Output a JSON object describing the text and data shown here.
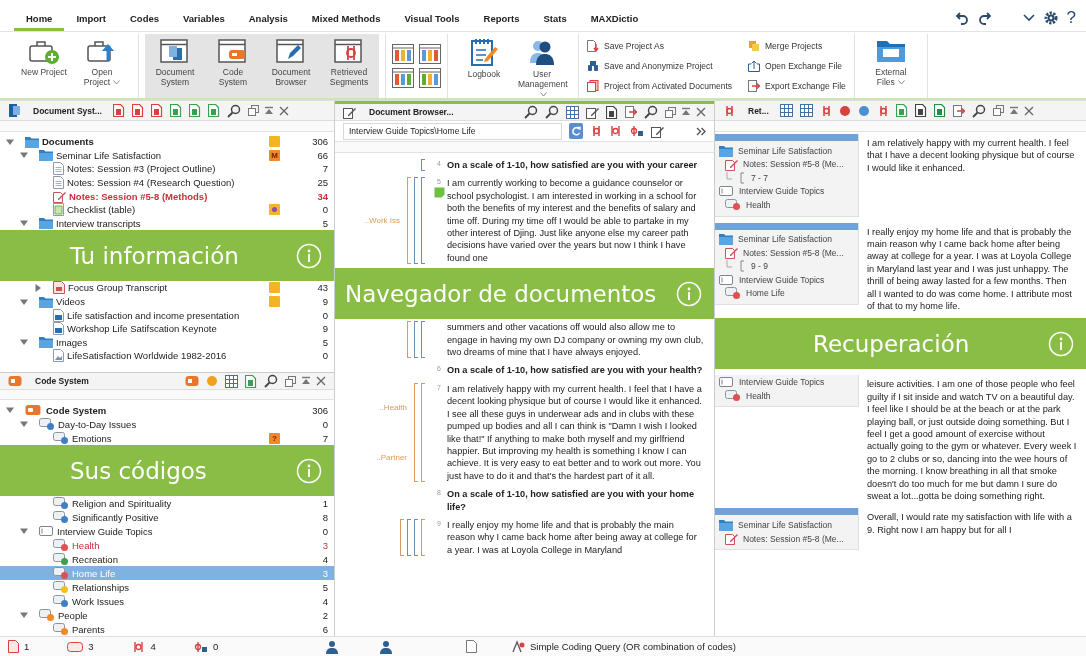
{
  "ribbon": {
    "tabs": [
      {
        "label": "Home",
        "selected": true
      },
      {
        "label": "Import",
        "selected": false
      },
      {
        "label": "Codes",
        "selected": false
      },
      {
        "label": "Variables",
        "selected": false
      },
      {
        "label": "Analysis",
        "selected": false
      },
      {
        "label": "Mixed Methods",
        "selected": false
      },
      {
        "label": "Visual Tools",
        "selected": false
      },
      {
        "label": "Reports",
        "selected": false
      },
      {
        "label": "Stats",
        "selected": false
      },
      {
        "label": "MAXDictio",
        "selected": false
      }
    ],
    "help": "?",
    "groups": [
      {
        "kind": "large",
        "active": false,
        "buttons": [
          {
            "label": "New Project",
            "dropdown": false
          },
          {
            "label": "Open Project",
            "dropdown": true
          }
        ]
      },
      {
        "kind": "large",
        "active": true,
        "buttons": [
          {
            "label": "Document System",
            "dropdown": false
          },
          {
            "label": "Code System",
            "dropdown": false
          },
          {
            "label": "Document Browser",
            "dropdown": false
          },
          {
            "label": "Retrieved Segments",
            "dropdown": false
          }
        ]
      },
      {
        "kind": "layouts"
      },
      {
        "kind": "large",
        "active": false,
        "buttons": [
          {
            "label": "Logbook",
            "dropdown": false
          },
          {
            "label": "User Management",
            "dropdown": true
          }
        ]
      },
      {
        "kind": "small",
        "buttons": [
          {
            "label": "Save Project As"
          },
          {
            "label": "Save and Anonymize Project"
          },
          {
            "label": "Project from Activated Documents"
          },
          {
            "label": "Merge Projects"
          },
          {
            "label": "Open Exchange File"
          },
          {
            "label": "Export Exchange File"
          }
        ]
      },
      {
        "kind": "large",
        "active": false,
        "buttons": [
          {
            "label": "External Files",
            "dropdown": true
          }
        ]
      }
    ]
  },
  "document_system": {
    "title": "Document Syst...",
    "banner": {
      "text": "Tu información"
    },
    "items": [
      {
        "kind": "folder",
        "label": "Documents",
        "count": "306",
        "activated": false,
        "expanded": true,
        "memo": {
          "kind": "plain"
        },
        "children": [
          {
            "kind": "folder",
            "label": "Seminar Life Satisfaction",
            "count": "66",
            "activated": false,
            "expanded": true,
            "memo": {
              "kind": "labeled",
              "label": "M"
            },
            "children": [
              {
                "kind": "text",
                "label": "Notes: Session #3 (Project Outline)",
                "count": "7",
                "activated": false
              },
              {
                "kind": "text",
                "label": "Notes: Session #4 (Research Question)",
                "count": "25",
                "activated": false
              },
              {
                "kind": "text",
                "label": "Notes: Session #5-8 (Methods)",
                "count": "34",
                "activated": true
              },
              {
                "kind": "table",
                "label": "Checklist (table)",
                "count": "0",
                "activated": false,
                "memo": {
                  "kind": "linked"
                }
              }
            ]
          },
          {
            "kind": "folder",
            "label": "Interview transcripts",
            "count": "5",
            "activated": false,
            "expanded": true,
            "children": [
              {
                "kind": "pdf",
                "label": "Focus Group Transcript",
                "count": "43",
                "activated": false,
                "expanded": false,
                "memo": {
                  "kind": "plain"
                }
              }
            ]
          },
          {
            "kind": "folder",
            "label": "Videos",
            "count": "9",
            "activated": false,
            "expanded": true,
            "memo": {
              "kind": "plain"
            },
            "children": [
              {
                "kind": "video",
                "label": "Life satisfaction and income presentation",
                "count": "0",
                "activated": false
              },
              {
                "kind": "video",
                "label": "Workshop Life Satifscation Keynote",
                "count": "9",
                "activated": false
              }
            ]
          },
          {
            "kind": "folder",
            "label": "Images",
            "count": "5",
            "activated": false,
            "expanded": true,
            "children": [
              {
                "kind": "image",
                "label": "LifeSatisfaction Worldwide 1982-2016",
                "count": "0",
                "activated": false
              }
            ]
          }
        ]
      }
    ]
  },
  "code_system": {
    "title": "Code System",
    "banner": {
      "text": "Sus códigos"
    },
    "items": [
      {
        "kind": "root",
        "label": "Code System",
        "count": "306",
        "selected": false,
        "activated": false,
        "expanded": true,
        "children": [
          {
            "kind": "code",
            "color": "#3f7fc8",
            "label": "Day-to-Day Issues",
            "count": "0",
            "selected": false,
            "activated": false,
            "expanded": true,
            "children": [
              {
                "kind": "code",
                "color": "#3f7fc8",
                "label": "Emotions",
                "count": "7",
                "selected": false,
                "activated": false,
                "memo": {
                  "kind": "labeled",
                  "label": "?"
                }
              },
              {
                "kind": "code",
                "color": "#3f7fc8",
                "label": "Religion and Spirituality",
                "count": "1",
                "selected": false,
                "activated": false
              },
              {
                "kind": "code",
                "color": "#3f7fc8",
                "label": "Significantly Positive",
                "count": "8",
                "selected": false,
                "activated": false
              }
            ]
          },
          {
            "kind": "set",
            "label": "Interview Guide Topics",
            "count": "0",
            "selected": false,
            "activated": false,
            "expanded": true,
            "children": [
              {
                "kind": "code",
                "color": "#e05050",
                "label": "Health",
                "count": "3",
                "selected": false,
                "activated": true
              },
              {
                "kind": "code",
                "color": "#3aa050",
                "label": "Recreation",
                "count": "4",
                "selected": false,
                "activated": false
              },
              {
                "kind": "code",
                "color": "#e05050",
                "label": "Home Life",
                "count": "3",
                "selected": true,
                "activated": true
              },
              {
                "kind": "code",
                "color": "#f0c020",
                "label": "Relationships",
                "count": "5",
                "selected": false,
                "activated": false
              },
              {
                "kind": "code",
                "color": "#3f7fc8",
                "label": "Work Issues",
                "count": "4",
                "selected": false,
                "activated": false
              }
            ]
          },
          {
            "kind": "code",
            "color": "#f08a24",
            "label": "People",
            "count": "2",
            "selected": false,
            "activated": false,
            "expanded": true,
            "children": [
              {
                "kind": "code",
                "color": "#f08a24",
                "label": "Parents",
                "count": "6",
                "selected": false,
                "activated": false
              }
            ]
          }
        ]
      }
    ]
  },
  "document_browser": {
    "title": "Document Browser...",
    "path": "Interview Guide Topics\\Home Life",
    "banner": {
      "text": "Navegador de documentos"
    },
    "blocks": [
      {
        "paragraphs": [
          {
            "number": "4",
            "kind": "question",
            "text": "On a scale of 1-10, how satisfied are you with your career",
            "codes": [
              {
                "color": "#6f8fb0"
              }
            ]
          },
          {
            "number": "5",
            "kind": "answer",
            "memo": true,
            "text": "I am currently working to become a guidance counselor or school psychologist.  I am interested in working in a school for both the benefits of my interest and the benefits of salary and time off.  During my time off I would be able to partake in my other interest of Djing.  Just like anyone else my career path decisions have varied over the years but now I think I have found one",
            "codes": [
              {
                "color": "#d99a5c",
                "label": "..Work Iss"
              },
              {
                "color": "#6f8fb0"
              },
              {
                "color": "#6f8fb0"
              }
            ]
          }
        ]
      },
      {
        "paragraphs": [
          {
            "kind": "answer",
            "text": "summers and other vacations off would also allow me to engage in having my own DJ company or owning my own club, two dreams of mine that I have always enjoyed.",
            "codes": [
              {
                "color": "#d99a5c"
              },
              {
                "color": "#6f8fb0"
              },
              {
                "color": "#6f8fb0"
              }
            ]
          },
          {
            "number": "6",
            "kind": "question",
            "text": "On a scale of 1-10, how satisfied are you with your health?"
          },
          {
            "number": "7",
            "kind": "answer",
            "text": "I am relatively happy with my current health.  I feel that I have a decent looking physique but of course I would like it enhanced.  I see all these guys in underwear ads and in clubs with these pumped up bodies and all I can think is \"Damn I wish I looked like that!\"  If anything to make both myself and my girlfriend happier.  But improving my health is something I know I can achieve.  It is very easy to eat better and to work out more.  You just have to do it and that's the hardest part of it all.",
            "codes": [
              {
                "color": "#d99a5c",
                "label": "..Health"
              },
              {
                "color": "#d99a5c",
                "label": "..Partner"
              }
            ]
          },
          {
            "number": "8",
            "kind": "question",
            "text": "On a scale of 1-10, how satisfied are you with your home life?"
          },
          {
            "number": "9",
            "kind": "answer",
            "text": "I really enjoy my home life and that is probably the main reason why I came back home after being away at college for a year.  I was at Loyola College in Maryland",
            "codes": [
              {
                "color": "#d99a5c"
              },
              {
                "color": "#6f8fb0"
              },
              {
                "color": "#6f8fb0"
              },
              {
                "color": "#d99a5c"
              }
            ]
          }
        ]
      }
    ]
  },
  "retrieved_segments": {
    "title": "Ret...",
    "banner": {
      "text": "Recuperación"
    },
    "segments": [
      {
        "document_group": "Seminar Life Satisfaction",
        "document": "Notes: Session #5-8 (Me...",
        "range": "7 - 7",
        "code_group": "Interview Guide Topics",
        "code": "Health",
        "color": "#e05050",
        "text": "I am relatively happy with my current health.  I feel that I have a decent looking physique but of course I would like it enhanced."
      },
      {
        "document_group": "Seminar Life Satisfaction",
        "document": "Notes: Session #5-8 (Me...",
        "range": "9 - 9",
        "code_group": "Interview Guide Topics",
        "code": "Home Life",
        "color": "#e05050",
        "text": "I really enjoy my home life and that is probably the main reason why I came back home after being away at college for a year.  I was at Loyola College in Maryland last year and I was just unhappy.  The thrill of being away lasted for a few months.  Then all I wanted to do was come home.  I attribute most of that to my home life."
      },
      {
        "code_group": "Interview Guide Topics",
        "code": "Health",
        "color": "#e05050",
        "text": "leisure activities.  I am one of those people who feel guilty if I sit inside and watch TV on a beautiful day.  I feel like I should be at the beach or at the park playing ball, or just outside doing something.  But I feel I get a good amount of exercise without actually going to the gym or whatever.  Every week I go to 2 clubs or so, dancing into the wee hours of the morning.  I know breathing in all that smoke doesn't do too much for me but damn I sure do sweat a lot...gotta be doing something right."
      },
      {
        "document_group": "Seminar Life Satisfaction",
        "document": "Notes: Session #5-8 (Me...",
        "text": "Overall, I would rate my satisfaction with life with a 9.  Right now I am happy but for all I"
      }
    ]
  },
  "status_bar": {
    "counters": [
      {
        "kind": "documents",
        "value": "1"
      },
      {
        "kind": "codes",
        "value": "3"
      },
      {
        "kind": "segments",
        "value": "4"
      },
      {
        "kind": "memos",
        "value": "0"
      }
    ],
    "query": "Simple Coding Query (OR combination of codes)"
  }
}
